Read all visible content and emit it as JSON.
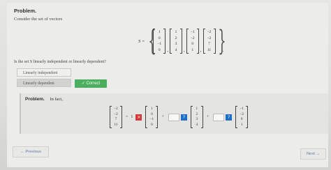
{
  "problem": {
    "title": "Problem.",
    "prompt": "Consider the set of vectors",
    "set_label": "S =",
    "vectors": [
      [
        "1",
        "0",
        "−1",
        "0"
      ],
      [
        "1",
        "2",
        "3",
        "4"
      ],
      [
        "−1",
        "−2",
        "0",
        "1"
      ],
      [
        "−2",
        "−2",
        "7",
        "11"
      ]
    ],
    "question": "Is the set S linearly independent or linearly dependent?",
    "options": [
      "Linearly independent",
      "Linearly dependent"
    ],
    "selected_option": "Linearly dependent",
    "feedback": "✓ Correct"
  },
  "followup": {
    "title": "Problem.",
    "lead": "In fact,",
    "lhs_vector": [
      "−2",
      "−2",
      "7",
      "11"
    ],
    "coef1": "1",
    "vec1": [
      "1",
      "0",
      "−1",
      "0"
    ],
    "vec2": [
      "1",
      "2",
      "3",
      "4"
    ],
    "vec3": [
      "−1",
      "−2",
      "0",
      "1"
    ],
    "equals": "=",
    "plus": "+",
    "wrong_mark": "×",
    "help_mark": "?"
  },
  "navigation": {
    "previous": "← Previous",
    "next": "Next →"
  },
  "colors": {
    "correct": "#4caf5f",
    "wrong": "#d13a3a",
    "help": "#1d6fc8"
  }
}
